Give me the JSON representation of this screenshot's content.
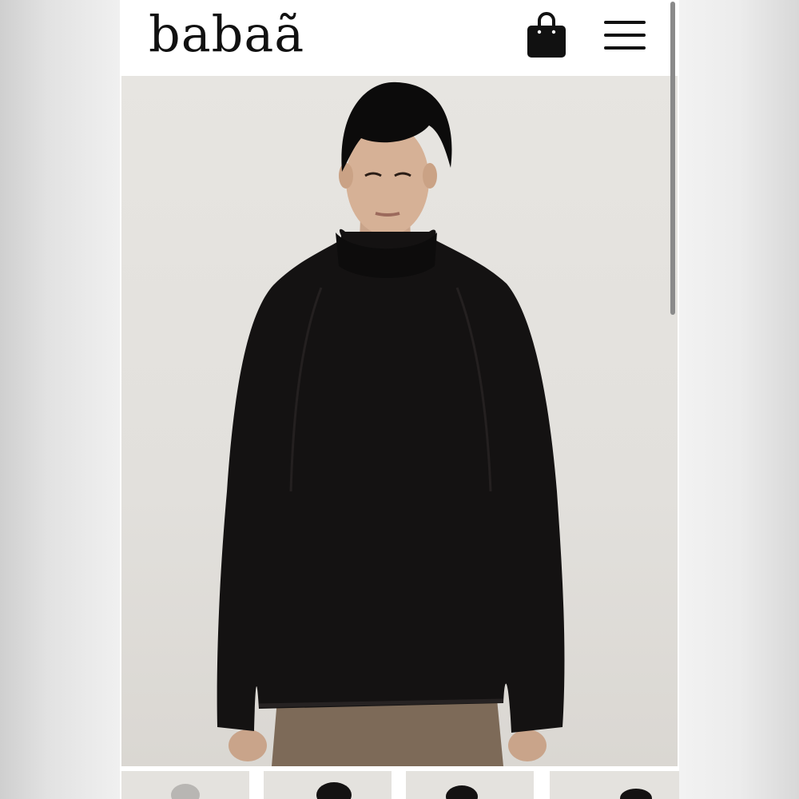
{
  "header": {
    "logo_text": "babaã",
    "bag_icon": "shopping-bag-icon",
    "menu_icon": "hamburger-menu-icon"
  },
  "hero": {
    "image": "model-wearing-black-roll-neck-knit-sweater",
    "sweater_color": "#141212",
    "skirt_color": "#7d6a58"
  },
  "thumbnails": [
    {
      "image": "thumbnail-1"
    },
    {
      "image": "thumbnail-2"
    },
    {
      "image": "thumbnail-3"
    },
    {
      "image": "thumbnail-4"
    }
  ],
  "colors": {
    "text": "#111111",
    "background": "#ffffff",
    "photo_background": "#e4e2de"
  }
}
